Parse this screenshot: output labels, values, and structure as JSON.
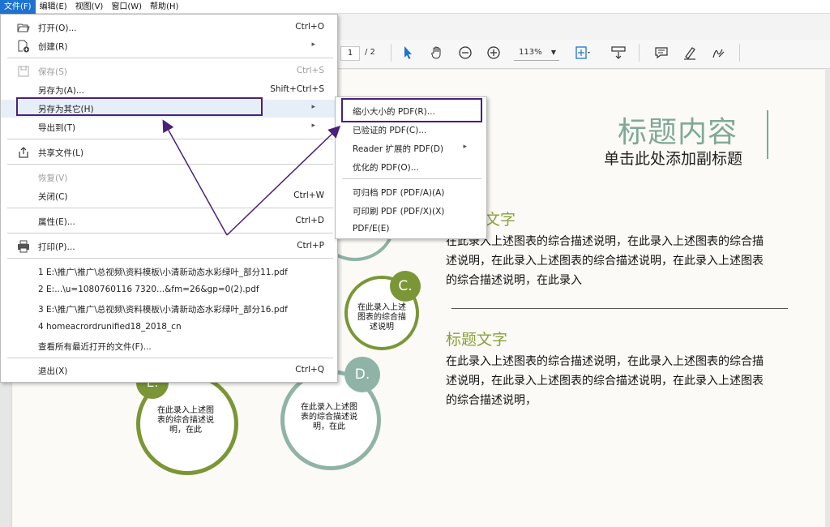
{
  "menubar": {
    "items": [
      "文件(F)",
      "编辑(E)",
      "视图(V)",
      "窗口(W)",
      "帮助(H)"
    ]
  },
  "toolbar": {
    "page_current": "1",
    "page_total": "/ 2",
    "zoom": "113%"
  },
  "file_menu": {
    "open": {
      "label": "打开(O)...",
      "shortcut": "Ctrl+O"
    },
    "create": {
      "label": "创建(R)"
    },
    "save": {
      "label": "保存(S)",
      "shortcut": "Ctrl+S"
    },
    "save_as": {
      "label": "另存为(A)...",
      "shortcut": "Shift+Ctrl+S"
    },
    "save_as_other": {
      "label": "另存为其它(H)"
    },
    "export_to": {
      "label": "导出到(T)"
    },
    "share_file": {
      "label": "共享文件(L)"
    },
    "revert": {
      "label": "恢复(V)"
    },
    "close": {
      "label": "关闭(C)",
      "shortcut": "Ctrl+W"
    },
    "properties": {
      "label": "属性(E)...",
      "shortcut": "Ctrl+D"
    },
    "print": {
      "label": "打印(P)...",
      "shortcut": "Ctrl+P"
    },
    "recent_files": [
      "1 E:\\推广\\推广\\总视频\\资料模板\\小清新动态水彩绿叶_部分11.pdf",
      "2 E:...\\u=1080760116 7320...&fm=26&gp=0(2).pdf",
      "3 E:\\推广\\推广\\总视频\\资料模板\\小清新动态水彩绿叶_部分16.pdf",
      "4 homeacrordrunified18_2018_cn"
    ],
    "view_all_recent": {
      "label": "查看所有最近打开的文件(F)..."
    },
    "exit": {
      "label": "退出(X)",
      "shortcut": "Ctrl+Q"
    }
  },
  "submenu": {
    "items": [
      "缩小大小的 PDF(R)...",
      "已验证的 PDF(C)...",
      "Reader 扩展的 PDF(D)",
      "优化的 PDF(O)...",
      "可归档 PDF (PDF/A)(A)",
      "可印刷 PDF (PDF/X)(X)",
      "PDF/E(E)"
    ]
  },
  "document": {
    "title": "标题内容",
    "subtitle": "单击此处添加副标题",
    "section1_title_partial": "文字",
    "section1_text": "在此录入上述图表的综合描述说明，在此录入上述图表的综合描述说明，在此录入上述图表的综合描述说明，在此录入上述图表的综合描述说明，在此录入",
    "section2_title": "标题文字",
    "section2_text": "在此录入上述图表的综合描述说明，在此录入上述图表的综合描述说明，在此录入上述图表的综合描述说明，在此录入上述图表的综合描述说明，",
    "circle_c_label": "C.",
    "circle_c_text": "在此录入上述图表的综合描述说明",
    "circle_d_label": "D.",
    "circle_d_text": "在此录入上述图表的综合描述说明，在此",
    "circle_e_label": "E.",
    "circle_e_text": "在此录入上述图表的综合描述说明，在此"
  },
  "colors": {
    "menu_active": "#1e73d2",
    "highlight_box": "#4b1f7a",
    "title_green": "#7fa996",
    "section_green": "#8aa23c",
    "ring_olive": "#7a9636",
    "ring_teal": "#8fb3a6"
  }
}
